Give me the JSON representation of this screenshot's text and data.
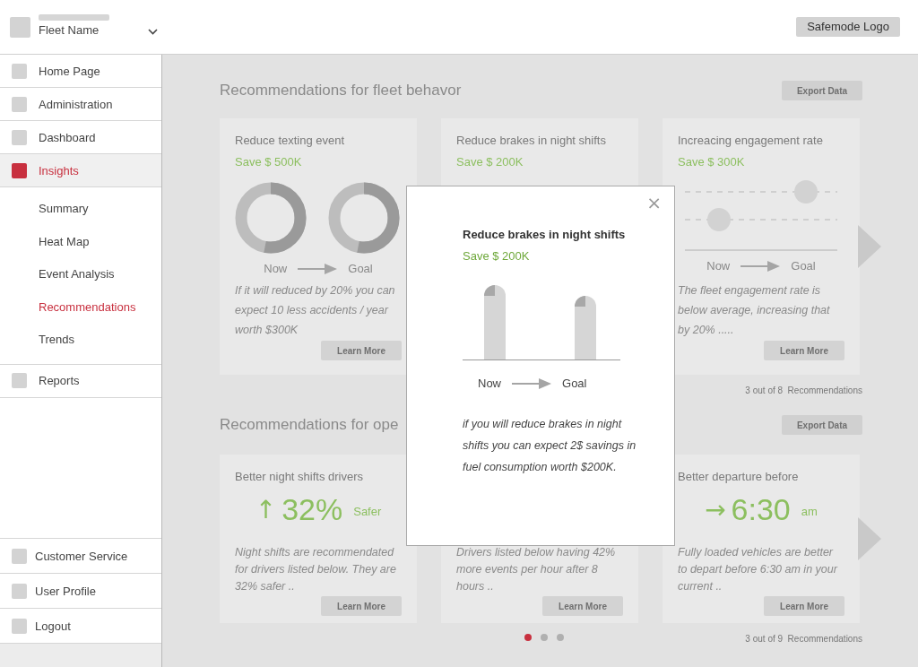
{
  "header": {
    "fleet_label": "Fleet Name",
    "logo": "Safemode Logo"
  },
  "sidebar": {
    "items": [
      {
        "label": "Home Page",
        "selected": false
      },
      {
        "label": "Administration",
        "selected": false
      },
      {
        "label": "Dashboard",
        "selected": false
      },
      {
        "label": "Insights",
        "selected": true,
        "children": [
          {
            "label": "Summary",
            "selected": false
          },
          {
            "label": "Heat Map",
            "selected": false
          },
          {
            "label": "Event Analysis",
            "selected": false
          },
          {
            "label": "Recommendations",
            "selected": true
          },
          {
            "label": "Trends",
            "selected": false
          }
        ]
      },
      {
        "label": "Reports",
        "selected": false
      }
    ],
    "bottom_items": [
      {
        "label": "Customer Service"
      },
      {
        "label": "User Profile"
      },
      {
        "label": "Logout"
      }
    ]
  },
  "sections": [
    {
      "title": "Recommendations for fleet behavor",
      "export": "Export Data",
      "counter": "3 out of 8  Recommendations",
      "cards": [
        {
          "kind": "donuts",
          "title": "Reduce texting event",
          "saving": "Save $ 500K",
          "from": "Now",
          "to": "Goal",
          "text": "If it will reduced by 20% you can expect 10 less accidents / year worth $300K",
          "button": "Learn More"
        },
        {
          "kind": "plain",
          "title": "Reduce brakes in night shifts",
          "saving": "Save $ 200K"
        },
        {
          "kind": "dots",
          "title": "Increacing engagement rate",
          "saving": "Save $ 300K",
          "from": "Now",
          "to": "Goal",
          "text": "The fleet engagement rate is below average, increasing that by 20%  .....",
          "button": "Learn More"
        }
      ]
    },
    {
      "title": "Recommendations for ope",
      "export": "Export Data",
      "counter": "3 out of 9  Recommendations",
      "pagination": [
        {
          "selected": true
        },
        {
          "selected": false
        },
        {
          "selected": false
        }
      ],
      "cards": [
        {
          "kind": "stat",
          "title": "Better night shifts drivers",
          "arrow": "↑",
          "stat": "32%",
          "unit": "Safer",
          "text": "Night shifts are recommendated for drivers listed below. They are 32% safer ..",
          "button": "Learn More"
        },
        {
          "kind": "plain",
          "text": "Drivers listed below having 42% more events per hour after 8 hours ..",
          "button": "Learn More"
        },
        {
          "kind": "stat",
          "title": "Better departure before",
          "arrow": "→",
          "stat": "6:30",
          "unit": "am",
          "text": "Fully loaded vehicles are better to depart before 6:30 am in your current ..",
          "button": "Learn More"
        }
      ]
    }
  ],
  "modal": {
    "close": "×",
    "title": "Reduce brakes in night shifts",
    "saving": "Save $ 200K",
    "from": "Now",
    "to": "Goal",
    "text": "if you will reduce brakes in night shifts you can expect 2$ savings in fuel consumption worth $200K."
  }
}
